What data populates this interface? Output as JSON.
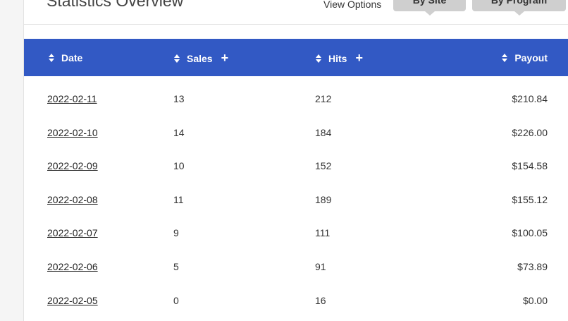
{
  "header": {
    "title": "Statistics Overview",
    "view_options_label": "View Options",
    "view_buttons": [
      {
        "label": "By Site"
      },
      {
        "label": "By Program"
      }
    ]
  },
  "table": {
    "columns": {
      "date": "Date",
      "sales": "Sales",
      "hits": "Hits",
      "payout": "Payout"
    },
    "rows": [
      {
        "date": "2022-02-11",
        "sales": "13",
        "hits": "212",
        "payout": "$210.84"
      },
      {
        "date": "2022-02-10",
        "sales": "14",
        "hits": "184",
        "payout": "$226.00"
      },
      {
        "date": "2022-02-09",
        "sales": "10",
        "hits": "152",
        "payout": "$154.58"
      },
      {
        "date": "2022-02-08",
        "sales": "11",
        "hits": "189",
        "payout": "$155.12"
      },
      {
        "date": "2022-02-07",
        "sales": "9",
        "hits": "111",
        "payout": "$100.05"
      },
      {
        "date": "2022-02-06",
        "sales": "5",
        "hits": "91",
        "payout": "$73.89"
      },
      {
        "date": "2022-02-05",
        "sales": "0",
        "hits": "16",
        "payout": "$0.00"
      }
    ]
  },
  "colors": {
    "header_blue": "#3259c4",
    "button_gray": "#cfcfcf"
  },
  "icons": {
    "sort": "sort-icon",
    "add_column": "plus-icon"
  }
}
